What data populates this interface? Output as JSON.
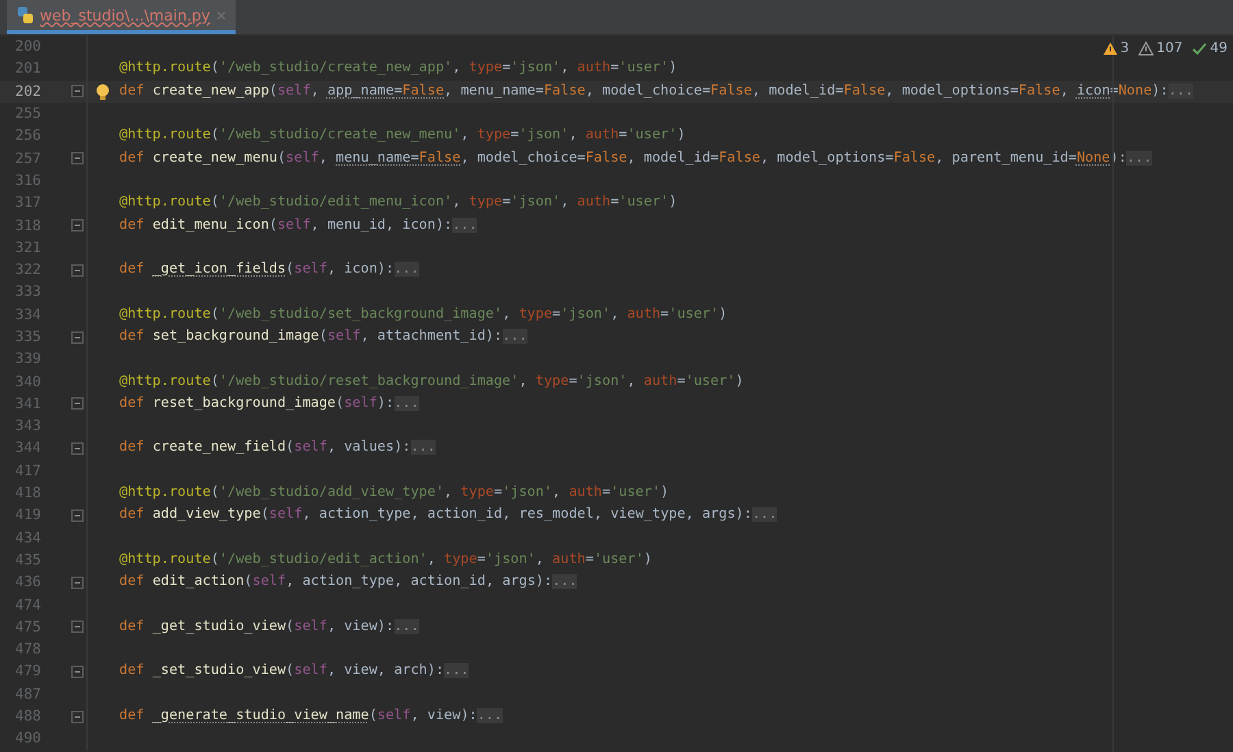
{
  "tab": {
    "title": "web_studio\\...\\main.py",
    "selected": true,
    "has_errors": true
  },
  "inspections": [
    {
      "kind": "warning",
      "count": "3"
    },
    {
      "kind": "weak_warning",
      "count": "107"
    },
    {
      "kind": "typo",
      "count": "49"
    }
  ],
  "lines": [
    {
      "number": "200",
      "current": false,
      "bulb": false,
      "fold": false
    },
    {
      "number": "201",
      "current": false,
      "bulb": false,
      "fold": false,
      "tokens": [
        {
          "kind": "dec",
          "text": "@http.route"
        },
        {
          "kind": "p",
          "text": "("
        },
        {
          "kind": "str",
          "text": "'/web_studio/create_new_app'"
        },
        {
          "kind": "p",
          "text": ", "
        },
        {
          "kind": "kwa",
          "text": "type"
        },
        {
          "kind": "p",
          "text": "="
        },
        {
          "kind": "str",
          "text": "'json'"
        },
        {
          "kind": "p",
          "text": ", "
        },
        {
          "kind": "kwa",
          "text": "auth"
        },
        {
          "kind": "p",
          "text": "="
        },
        {
          "kind": "str",
          "text": "'user'"
        },
        {
          "kind": "p",
          "text": ")"
        }
      ]
    },
    {
      "number": "202",
      "current": true,
      "bulb": true,
      "fold": true,
      "tokens": [
        {
          "kind": "kw",
          "text": "def "
        },
        {
          "kind": "fn",
          "text": "create_new_app"
        },
        {
          "kind": "p",
          "text": "("
        },
        {
          "kind": "self",
          "text": "self"
        },
        {
          "kind": "p",
          "text": ", "
        },
        {
          "kind": "par_u",
          "text": "app_name"
        },
        {
          "kind": "p_u",
          "text": "="
        },
        {
          "kind": "const_u",
          "text": "False"
        },
        {
          "kind": "p",
          "text": ", "
        },
        {
          "kind": "par",
          "text": "menu_name"
        },
        {
          "kind": "p",
          "text": "="
        },
        {
          "kind": "const",
          "text": "False"
        },
        {
          "kind": "p",
          "text": ", "
        },
        {
          "kind": "par",
          "text": "model_choice"
        },
        {
          "kind": "p",
          "text": "="
        },
        {
          "kind": "const",
          "text": "False"
        },
        {
          "kind": "p",
          "text": ", "
        },
        {
          "kind": "par",
          "text": "model_id"
        },
        {
          "kind": "p",
          "text": "="
        },
        {
          "kind": "const",
          "text": "False"
        },
        {
          "kind": "p",
          "text": ", "
        },
        {
          "kind": "par",
          "text": "model_options"
        },
        {
          "kind": "p",
          "text": "="
        },
        {
          "kind": "const",
          "text": "False"
        },
        {
          "kind": "p",
          "text": ", "
        },
        {
          "kind": "par_u",
          "text": "icon"
        },
        {
          "kind": "p",
          "text": "="
        },
        {
          "kind": "const",
          "text": "None"
        },
        {
          "kind": "p",
          "text": "):"
        },
        {
          "kind": "fold",
          "text": "..."
        }
      ]
    },
    {
      "number": "255",
      "current": false,
      "bulb": false,
      "fold": false
    },
    {
      "number": "256",
      "current": false,
      "bulb": false,
      "fold": false,
      "tokens": [
        {
          "kind": "dec",
          "text": "@http.route"
        },
        {
          "kind": "p",
          "text": "("
        },
        {
          "kind": "str",
          "text": "'/web_studio/create_new_menu'"
        },
        {
          "kind": "p",
          "text": ", "
        },
        {
          "kind": "kwa",
          "text": "type"
        },
        {
          "kind": "p",
          "text": "="
        },
        {
          "kind": "str",
          "text": "'json'"
        },
        {
          "kind": "p",
          "text": ", "
        },
        {
          "kind": "kwa",
          "text": "auth"
        },
        {
          "kind": "p",
          "text": "="
        },
        {
          "kind": "str",
          "text": "'user'"
        },
        {
          "kind": "p",
          "text": ")"
        }
      ]
    },
    {
      "number": "257",
      "current": false,
      "bulb": false,
      "fold": true,
      "tokens": [
        {
          "kind": "kw",
          "text": "def "
        },
        {
          "kind": "fn",
          "text": "create_new_menu"
        },
        {
          "kind": "p",
          "text": "("
        },
        {
          "kind": "self",
          "text": "self"
        },
        {
          "kind": "p",
          "text": ", "
        },
        {
          "kind": "par_u",
          "text": "menu_name"
        },
        {
          "kind": "p_u",
          "text": "="
        },
        {
          "kind": "const_u",
          "text": "False"
        },
        {
          "kind": "p",
          "text": ", "
        },
        {
          "kind": "par",
          "text": "model_choice"
        },
        {
          "kind": "p",
          "text": "="
        },
        {
          "kind": "const",
          "text": "False"
        },
        {
          "kind": "p",
          "text": ", "
        },
        {
          "kind": "par",
          "text": "model_id"
        },
        {
          "kind": "p",
          "text": "="
        },
        {
          "kind": "const",
          "text": "False"
        },
        {
          "kind": "p",
          "text": ", "
        },
        {
          "kind": "par",
          "text": "model_options"
        },
        {
          "kind": "p",
          "text": "="
        },
        {
          "kind": "const",
          "text": "False"
        },
        {
          "kind": "p",
          "text": ", "
        },
        {
          "kind": "par",
          "text": "parent_menu_id"
        },
        {
          "kind": "p",
          "text": "="
        },
        {
          "kind": "const_u",
          "text": "None"
        },
        {
          "kind": "p",
          "text": "):"
        },
        {
          "kind": "fold",
          "text": "..."
        }
      ]
    },
    {
      "number": "316",
      "current": false,
      "bulb": false,
      "fold": false
    },
    {
      "number": "317",
      "current": false,
      "bulb": false,
      "fold": false,
      "tokens": [
        {
          "kind": "dec",
          "text": "@http.route"
        },
        {
          "kind": "p",
          "text": "("
        },
        {
          "kind": "str",
          "text": "'/web_studio/edit_menu_icon'"
        },
        {
          "kind": "p",
          "text": ", "
        },
        {
          "kind": "kwa",
          "text": "type"
        },
        {
          "kind": "p",
          "text": "="
        },
        {
          "kind": "str",
          "text": "'json'"
        },
        {
          "kind": "p",
          "text": ", "
        },
        {
          "kind": "kwa",
          "text": "auth"
        },
        {
          "kind": "p",
          "text": "="
        },
        {
          "kind": "str",
          "text": "'user'"
        },
        {
          "kind": "p",
          "text": ")"
        }
      ]
    },
    {
      "number": "318",
      "current": false,
      "bulb": false,
      "fold": true,
      "tokens": [
        {
          "kind": "kw",
          "text": "def "
        },
        {
          "kind": "fn",
          "text": "edit_menu_icon"
        },
        {
          "kind": "p",
          "text": "("
        },
        {
          "kind": "self",
          "text": "self"
        },
        {
          "kind": "p",
          "text": ", "
        },
        {
          "kind": "par",
          "text": "menu_id"
        },
        {
          "kind": "p",
          "text": ", "
        },
        {
          "kind": "par",
          "text": "icon"
        },
        {
          "kind": "p",
          "text": "):"
        },
        {
          "kind": "fold",
          "text": "..."
        }
      ]
    },
    {
      "number": "321",
      "current": false,
      "bulb": false,
      "fold": false
    },
    {
      "number": "322",
      "current": false,
      "bulb": false,
      "fold": true,
      "tokens": [
        {
          "kind": "kw",
          "text": "def "
        },
        {
          "kind": "fn_u",
          "text": "_get_icon_fields"
        },
        {
          "kind": "p",
          "text": "("
        },
        {
          "kind": "self",
          "text": "self"
        },
        {
          "kind": "p",
          "text": ", "
        },
        {
          "kind": "par",
          "text": "icon"
        },
        {
          "kind": "p",
          "text": "):"
        },
        {
          "kind": "fold",
          "text": "..."
        }
      ]
    },
    {
      "number": "333",
      "current": false,
      "bulb": false,
      "fold": false
    },
    {
      "number": "334",
      "current": false,
      "bulb": false,
      "fold": false,
      "tokens": [
        {
          "kind": "dec",
          "text": "@http.route"
        },
        {
          "kind": "p",
          "text": "("
        },
        {
          "kind": "str",
          "text": "'/web_studio/set_background_image'"
        },
        {
          "kind": "p",
          "text": ", "
        },
        {
          "kind": "kwa",
          "text": "type"
        },
        {
          "kind": "p",
          "text": "="
        },
        {
          "kind": "str",
          "text": "'json'"
        },
        {
          "kind": "p",
          "text": ", "
        },
        {
          "kind": "kwa",
          "text": "auth"
        },
        {
          "kind": "p",
          "text": "="
        },
        {
          "kind": "str",
          "text": "'user'"
        },
        {
          "kind": "p",
          "text": ")"
        }
      ]
    },
    {
      "number": "335",
      "current": false,
      "bulb": false,
      "fold": true,
      "tokens": [
        {
          "kind": "kw",
          "text": "def "
        },
        {
          "kind": "fn",
          "text": "set_background_image"
        },
        {
          "kind": "p",
          "text": "("
        },
        {
          "kind": "self",
          "text": "self"
        },
        {
          "kind": "p",
          "text": ", "
        },
        {
          "kind": "par",
          "text": "attachment_id"
        },
        {
          "kind": "p",
          "text": "):"
        },
        {
          "kind": "fold",
          "text": "..."
        }
      ]
    },
    {
      "number": "339",
      "current": false,
      "bulb": false,
      "fold": false
    },
    {
      "number": "340",
      "current": false,
      "bulb": false,
      "fold": false,
      "tokens": [
        {
          "kind": "dec",
          "text": "@http.route"
        },
        {
          "kind": "p",
          "text": "("
        },
        {
          "kind": "str",
          "text": "'/web_studio/reset_background_image'"
        },
        {
          "kind": "p",
          "text": ", "
        },
        {
          "kind": "kwa",
          "text": "type"
        },
        {
          "kind": "p",
          "text": "="
        },
        {
          "kind": "str",
          "text": "'json'"
        },
        {
          "kind": "p",
          "text": ", "
        },
        {
          "kind": "kwa",
          "text": "auth"
        },
        {
          "kind": "p",
          "text": "="
        },
        {
          "kind": "str",
          "text": "'user'"
        },
        {
          "kind": "p",
          "text": ")"
        }
      ]
    },
    {
      "number": "341",
      "current": false,
      "bulb": false,
      "fold": true,
      "tokens": [
        {
          "kind": "kw",
          "text": "def "
        },
        {
          "kind": "fn",
          "text": "reset_background_image"
        },
        {
          "kind": "p",
          "text": "("
        },
        {
          "kind": "self",
          "text": "self"
        },
        {
          "kind": "p",
          "text": "):"
        },
        {
          "kind": "fold",
          "text": "..."
        }
      ]
    },
    {
      "number": "343",
      "current": false,
      "bulb": false,
      "fold": false
    },
    {
      "number": "344",
      "current": false,
      "bulb": false,
      "fold": true,
      "tokens": [
        {
          "kind": "kw",
          "text": "def "
        },
        {
          "kind": "fn",
          "text": "create_new_field"
        },
        {
          "kind": "p",
          "text": "("
        },
        {
          "kind": "self",
          "text": "self"
        },
        {
          "kind": "p",
          "text": ", "
        },
        {
          "kind": "par",
          "text": "values"
        },
        {
          "kind": "p",
          "text": "):"
        },
        {
          "kind": "fold",
          "text": "..."
        }
      ]
    },
    {
      "number": "417",
      "current": false,
      "bulb": false,
      "fold": false
    },
    {
      "number": "418",
      "current": false,
      "bulb": false,
      "fold": false,
      "tokens": [
        {
          "kind": "dec",
          "text": "@http.route"
        },
        {
          "kind": "p",
          "text": "("
        },
        {
          "kind": "str",
          "text": "'/web_studio/add_view_type'"
        },
        {
          "kind": "p",
          "text": ", "
        },
        {
          "kind": "kwa",
          "text": "type"
        },
        {
          "kind": "p",
          "text": "="
        },
        {
          "kind": "str",
          "text": "'json'"
        },
        {
          "kind": "p",
          "text": ", "
        },
        {
          "kind": "kwa",
          "text": "auth"
        },
        {
          "kind": "p",
          "text": "="
        },
        {
          "kind": "str",
          "text": "'user'"
        },
        {
          "kind": "p",
          "text": ")"
        }
      ]
    },
    {
      "number": "419",
      "current": false,
      "bulb": false,
      "fold": true,
      "tokens": [
        {
          "kind": "kw",
          "text": "def "
        },
        {
          "kind": "fn",
          "text": "add_view_type"
        },
        {
          "kind": "p",
          "text": "("
        },
        {
          "kind": "self",
          "text": "self"
        },
        {
          "kind": "p",
          "text": ", "
        },
        {
          "kind": "par",
          "text": "action_type"
        },
        {
          "kind": "p",
          "text": ", "
        },
        {
          "kind": "par",
          "text": "action_id"
        },
        {
          "kind": "p",
          "text": ", "
        },
        {
          "kind": "par",
          "text": "res_model"
        },
        {
          "kind": "p",
          "text": ", "
        },
        {
          "kind": "par",
          "text": "view_type"
        },
        {
          "kind": "p",
          "text": ", "
        },
        {
          "kind": "par",
          "text": "args"
        },
        {
          "kind": "p",
          "text": "):"
        },
        {
          "kind": "fold",
          "text": "..."
        }
      ]
    },
    {
      "number": "434",
      "current": false,
      "bulb": false,
      "fold": false
    },
    {
      "number": "435",
      "current": false,
      "bulb": false,
      "fold": false,
      "tokens": [
        {
          "kind": "dec",
          "text": "@http.route"
        },
        {
          "kind": "p",
          "text": "("
        },
        {
          "kind": "str",
          "text": "'/web_studio/edit_action'"
        },
        {
          "kind": "p",
          "text": ", "
        },
        {
          "kind": "kwa",
          "text": "type"
        },
        {
          "kind": "p",
          "text": "="
        },
        {
          "kind": "str",
          "text": "'json'"
        },
        {
          "kind": "p",
          "text": ", "
        },
        {
          "kind": "kwa",
          "text": "auth"
        },
        {
          "kind": "p",
          "text": "="
        },
        {
          "kind": "str",
          "text": "'user'"
        },
        {
          "kind": "p",
          "text": ")"
        }
      ]
    },
    {
      "number": "436",
      "current": false,
      "bulb": false,
      "fold": true,
      "tokens": [
        {
          "kind": "kw",
          "text": "def "
        },
        {
          "kind": "fn",
          "text": "edit_action"
        },
        {
          "kind": "p",
          "text": "("
        },
        {
          "kind": "self",
          "text": "self"
        },
        {
          "kind": "p",
          "text": ", "
        },
        {
          "kind": "par",
          "text": "action_type"
        },
        {
          "kind": "p",
          "text": ", "
        },
        {
          "kind": "par",
          "text": "action_id"
        },
        {
          "kind": "p",
          "text": ", "
        },
        {
          "kind": "par",
          "text": "args"
        },
        {
          "kind": "p",
          "text": "):"
        },
        {
          "kind": "fold",
          "text": "..."
        }
      ]
    },
    {
      "number": "474",
      "current": false,
      "bulb": false,
      "fold": false
    },
    {
      "number": "475",
      "current": false,
      "bulb": false,
      "fold": true,
      "tokens": [
        {
          "kind": "kw",
          "text": "def "
        },
        {
          "kind": "fn",
          "text": "_get_studio_view"
        },
        {
          "kind": "p",
          "text": "("
        },
        {
          "kind": "self",
          "text": "self"
        },
        {
          "kind": "p",
          "text": ", "
        },
        {
          "kind": "par",
          "text": "view"
        },
        {
          "kind": "p",
          "text": "):"
        },
        {
          "kind": "fold",
          "text": "..."
        }
      ]
    },
    {
      "number": "478",
      "current": false,
      "bulb": false,
      "fold": false
    },
    {
      "number": "479",
      "current": false,
      "bulb": false,
      "fold": true,
      "tokens": [
        {
          "kind": "kw",
          "text": "def "
        },
        {
          "kind": "fn",
          "text": "_set_studio_view"
        },
        {
          "kind": "p",
          "text": "("
        },
        {
          "kind": "self",
          "text": "self"
        },
        {
          "kind": "p",
          "text": ", "
        },
        {
          "kind": "par",
          "text": "view"
        },
        {
          "kind": "p",
          "text": ", "
        },
        {
          "kind": "par",
          "text": "arch"
        },
        {
          "kind": "p",
          "text": "):"
        },
        {
          "kind": "fold",
          "text": "..."
        }
      ]
    },
    {
      "number": "487",
      "current": false,
      "bulb": false,
      "fold": false
    },
    {
      "number": "488",
      "current": false,
      "bulb": false,
      "fold": true,
      "tokens": [
        {
          "kind": "kw",
          "text": "def "
        },
        {
          "kind": "fn_u",
          "text": "_generate_studio_view_name"
        },
        {
          "kind": "p",
          "text": "("
        },
        {
          "kind": "self",
          "text": "self"
        },
        {
          "kind": "p",
          "text": ", "
        },
        {
          "kind": "par",
          "text": "view"
        },
        {
          "kind": "p",
          "text": "):"
        },
        {
          "kind": "fold",
          "text": "..."
        }
      ]
    },
    {
      "number": "490",
      "current": false,
      "bulb": false,
      "fold": false
    }
  ]
}
